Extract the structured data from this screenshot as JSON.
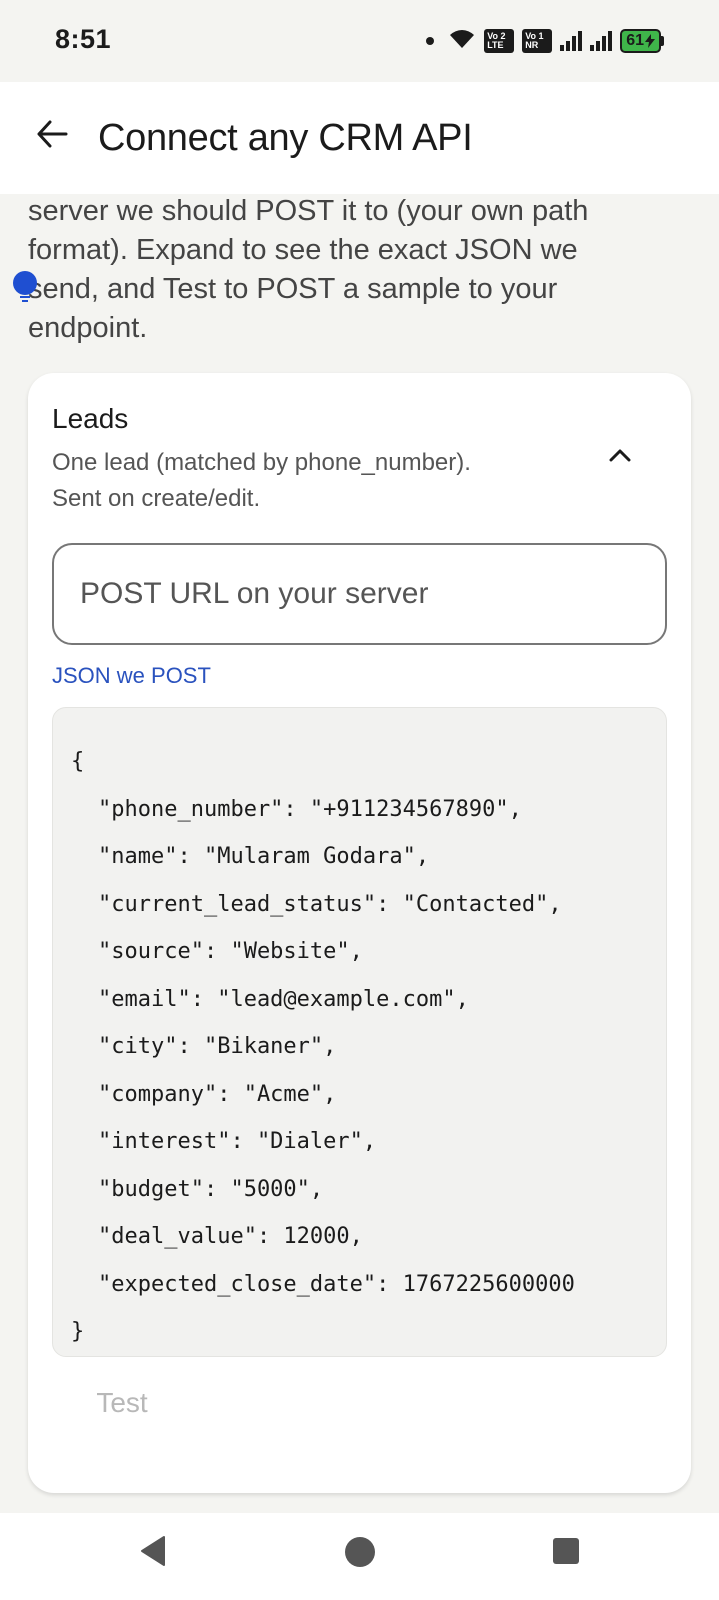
{
  "status_bar": {
    "time": "8:51",
    "sim1_label_top": "Vo 2",
    "sim1_label_bottom": "LTE",
    "sim2_label_top": "Vo 1",
    "sim2_label_bottom": "NR",
    "battery": "61"
  },
  "app_bar": {
    "title": "Connect any CRM API"
  },
  "intro": {
    "line1": "server we should POST it to (your own path",
    "line2": "format). Expand to see the exact JSON we",
    "line3": "send, and Test to POST a sample to your",
    "line4": "endpoint."
  },
  "card": {
    "title": "Leads",
    "desc_line1": "One lead (matched by phone_number).",
    "desc_line2": "Sent on create/edit.",
    "url_placeholder": "POST URL on your server",
    "json_link": "JSON we POST",
    "code": {
      "open": "{",
      "lines": [
        "\"phone_number\": \"+911234567890\",",
        "\"name\": \"Mularam Godara\",",
        "\"current_lead_status\": \"Contacted\",",
        "\"source\": \"Website\",",
        "\"email\": \"lead@example.com\",",
        "\"city\": \"Bikaner\",",
        "\"company\": \"Acme\",",
        "\"interest\": \"Dialer\",",
        "\"budget\": \"5000\",",
        "\"deal_value\": 12000,",
        "\"expected_close_date\": 1767225600000"
      ],
      "close": "}"
    },
    "test_button": "Test"
  },
  "colors": {
    "accent_link": "#2a52be",
    "battery_green": "#3fb54a",
    "background": "#f4f4f1"
  }
}
